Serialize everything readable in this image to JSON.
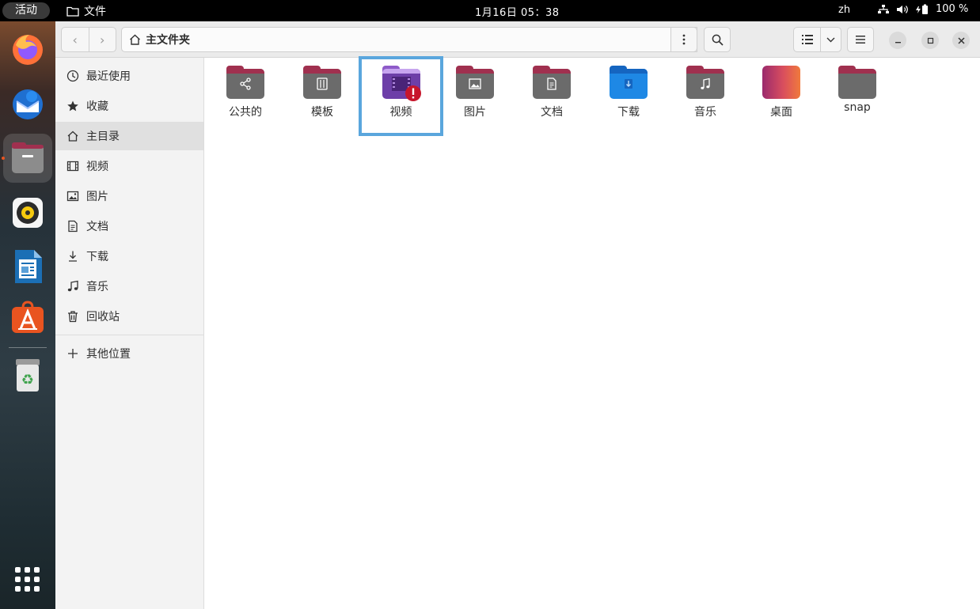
{
  "topbar": {
    "activities": "活动",
    "app_name": "文件",
    "clock": "1月16日  05：38",
    "lang": "zh",
    "battery": "100 %"
  },
  "dock": {
    "items": [
      "firefox-icon",
      "thunderbird-icon",
      "files-icon",
      "rhythmbox-icon",
      "libreoffice-writer-icon",
      "app-center-icon",
      "trash-icon",
      "show-apps-icon"
    ]
  },
  "header": {
    "location": "主文件夹"
  },
  "sidebar": {
    "items": [
      {
        "label": "最近使用",
        "icon": "clock-icon"
      },
      {
        "label": "收藏",
        "icon": "star-icon"
      },
      {
        "label": "主目录",
        "icon": "home-icon"
      },
      {
        "label": "视频",
        "icon": "film-icon"
      },
      {
        "label": "图片",
        "icon": "image-icon"
      },
      {
        "label": "文档",
        "icon": "document-icon"
      },
      {
        "label": "下载",
        "icon": "download-icon"
      },
      {
        "label": "音乐",
        "icon": "music-icon"
      },
      {
        "label": "回收站",
        "icon": "trash-icon"
      },
      {
        "label": "其他位置",
        "icon": "plus-icon"
      }
    ]
  },
  "files": [
    {
      "label": "公共的",
      "icon": "share-icon"
    },
    {
      "label": "模板",
      "icon": "template-icon"
    },
    {
      "label": "视频",
      "icon": "video-folder-warning-icon"
    },
    {
      "label": "图片",
      "icon": "image-icon"
    },
    {
      "label": "文档",
      "icon": "document-icon"
    },
    {
      "label": "下载",
      "icon": "download-icon"
    },
    {
      "label": "音乐",
      "icon": "music-icon"
    },
    {
      "label": "桌面",
      "icon": "desktop-folder-icon"
    },
    {
      "label": "snap",
      "icon": "folder-icon"
    }
  ],
  "colors": {
    "folder_body": "#6b6b6b",
    "folder_accent": "#a0304f",
    "download_blue": "#1e88e5",
    "video_purple": "#6d3fa8",
    "highlight": "#5aa6dd",
    "ubuntu_orange": "#e95420"
  }
}
